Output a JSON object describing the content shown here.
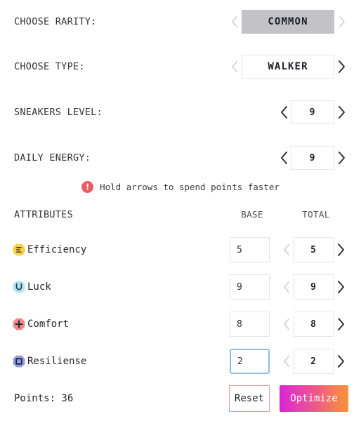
{
  "selectors": [
    {
      "label": "CHOOSE RARITY:",
      "value": "COMMON",
      "style": "filled",
      "prev_enabled": false,
      "next_enabled": false,
      "prev_icon": "chevron-left-icon",
      "next_icon": "chevron-right-icon",
      "name": "rarity"
    },
    {
      "label": "CHOOSE TYPE:",
      "value": "WALKER",
      "style": "outline",
      "prev_enabled": false,
      "next_enabled": true,
      "prev_icon": "chevron-left-icon",
      "next_icon": "chevron-right-icon",
      "name": "type"
    }
  ],
  "numbers": [
    {
      "label": "SNEAKERS LEVEL:",
      "value": "9",
      "prev_enabled": true,
      "next_enabled": true,
      "name": "sneakers-level"
    },
    {
      "label": "DAILY ENERGY:",
      "value": "9",
      "prev_enabled": true,
      "next_enabled": true,
      "name": "daily-energy"
    }
  ],
  "hint": {
    "icon": "warning-exclamation-icon",
    "icon_glyph": "!",
    "text": "Hold arrows to spend points faster",
    "icon_color": "#ee5a61"
  },
  "attributes_header": {
    "name_col": "ATTRIBUTES",
    "base_col": "BASE",
    "total_col": "TOTAL"
  },
  "attributes": [
    {
      "name": "Efficiency",
      "icon": "efficiency-icon",
      "icon_color": "#f7d046",
      "icon_glyph": "lines",
      "base": "5",
      "total": "5",
      "base_focused": false,
      "prev_enabled": false,
      "next_enabled": true,
      "slug": "efficiency"
    },
    {
      "name": "Luck",
      "icon": "luck-icon",
      "icon_color": "#aee4f0",
      "icon_glyph": "U",
      "base": "9",
      "total": "9",
      "base_focused": false,
      "prev_enabled": false,
      "next_enabled": true,
      "slug": "luck"
    },
    {
      "name": "Comfort",
      "icon": "comfort-icon",
      "icon_color": "#f08a8e",
      "icon_glyph": "plus",
      "base": "8",
      "total": "8",
      "base_focused": false,
      "prev_enabled": false,
      "next_enabled": true,
      "slug": "comfort"
    },
    {
      "name": "Resiliense",
      "icon": "resiliense-icon",
      "icon_color": "#8f9ce0",
      "icon_glyph": "square",
      "base": "2",
      "total": "2",
      "base_focused": true,
      "prev_enabled": false,
      "next_enabled": true,
      "slug": "resiliense"
    }
  ],
  "footer": {
    "points_label": "Points: 36",
    "reset_label": "Reset",
    "optimize_label": "Optimize",
    "reset_border_color": "#e09b9b",
    "optimize_gradient_from": "#d925d4",
    "optimize_gradient_to": "#f7913c"
  }
}
